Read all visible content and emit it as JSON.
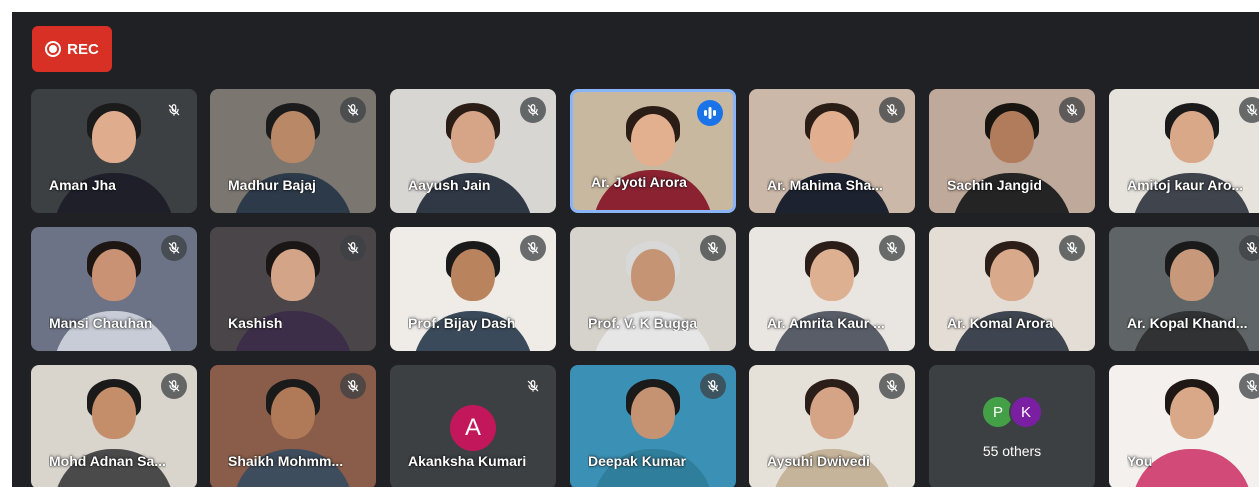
{
  "rec_label": "REC",
  "participants": [
    {
      "name": "Aman Jha",
      "muted": true,
      "bg": "#3c4043",
      "skin": "#e0ac8e",
      "hair": "#1b1b1b",
      "shirt": "#1f1f2a"
    },
    {
      "name": "Madhur Bajaj",
      "muted": true,
      "bg": "#7b7670",
      "skin": "#b98866",
      "hair": "#1b1b1b",
      "shirt": "#2c3a4a"
    },
    {
      "name": "Aayush Jain",
      "muted": true,
      "bg": "#d8d6d3",
      "skin": "#d6a487",
      "hair": "#2a1d16",
      "shirt": "#303846"
    },
    {
      "name": "Ar. Jyoti Arora",
      "muted": false,
      "speaking": true,
      "bg": "#c8b8a0",
      "skin": "#e3b08f",
      "hair": "#2a1d16",
      "shirt": "#8a2231"
    },
    {
      "name": "Ar. Mahima Sha...",
      "muted": true,
      "bg": "#cbb8a8",
      "skin": "#e2ae90",
      "hair": "#2a1d16",
      "shirt": "#1d2230"
    },
    {
      "name": "Sachin Jangid",
      "muted": true,
      "bg": "#bfa99a",
      "skin": "#b07c5c",
      "hair": "#181410",
      "shirt": "#242424"
    },
    {
      "name": "Amitoj kaur Aro...",
      "muted": true,
      "bg": "#e6e2dc",
      "skin": "#d8a888",
      "hair": "#1a1a1a",
      "shirt": "#40454d"
    },
    {
      "name": "Mansi Chauhan",
      "muted": true,
      "bg": "#6d7386",
      "skin": "#c99274",
      "hair": "#1e1612",
      "shirt": "#c7ccd6"
    },
    {
      "name": "Kashish",
      "muted": true,
      "bg": "#4a4548",
      "skin": "#d3a487",
      "hair": "#1b1616",
      "shirt": "#3c2e48"
    },
    {
      "name": "Prof. Bijay Dash",
      "muted": true,
      "bg": "#efece8",
      "skin": "#b8835d",
      "hair": "#1a1a1a",
      "shirt": "#3a4a5a"
    },
    {
      "name": "Prof. V. K Bugga",
      "muted": true,
      "bg": "#d6d2cc",
      "skin": "#c49474",
      "hair": "#d8d8d8",
      "shirt": "#e6e6e6"
    },
    {
      "name": "Ar. Amrita Kaur ...",
      "muted": true,
      "bg": "#e9e5e0",
      "skin": "#ddb091",
      "hair": "#2b1d18",
      "shirt": "#585d68"
    },
    {
      "name": "Ar. Komal Arora",
      "muted": true,
      "bg": "#e4ddd6",
      "skin": "#d8a98a",
      "hair": "#2b1d18",
      "shirt": "#3f4550"
    },
    {
      "name": "Ar. Kopal Khand...",
      "muted": true,
      "bg": "#5f6566",
      "skin": "#c7987a",
      "hair": "#1a1a1a",
      "shirt": "#303233"
    },
    {
      "name": "Mohd Adnan Sa...",
      "muted": true,
      "bg": "#d9d4cc",
      "skin": "#c58e6a",
      "hair": "#1a1a1a",
      "shirt": "#4a4a4a"
    },
    {
      "name": "Shaikh Mohmm...",
      "muted": true,
      "bg": "#8a5d4a",
      "skin": "#b07a58",
      "hair": "#1a1a1a",
      "shirt": "#3e4d5d"
    },
    {
      "name": "Akanksha Kumari",
      "muted": true,
      "avatar": true,
      "initial": "A",
      "avatar_color": "#c2185b",
      "bg": "#3c4043"
    },
    {
      "name": "Deepak Kumar",
      "muted": true,
      "bg": "#3b90b5",
      "skin": "#c59272",
      "hair": "#1a1a1a",
      "shirt": "#2f7e9b"
    },
    {
      "name": "Aysuhi Dwivedi",
      "muted": true,
      "bg": "#e6e1d8",
      "skin": "#d5a386",
      "hair": "#2b1d18",
      "shirt": "#c5b39a"
    },
    {
      "others": true,
      "label": "55 others",
      "initials": [
        {
          "letter": "P",
          "color": "#43a047"
        },
        {
          "letter": "K",
          "color": "#7b1fa2"
        }
      ],
      "bg": "#3c4043"
    },
    {
      "name": "You",
      "muted": true,
      "bg": "#f3f0ed",
      "skin": "#d8a888",
      "hair": "#1f1714",
      "shirt": "#d14a78"
    }
  ]
}
